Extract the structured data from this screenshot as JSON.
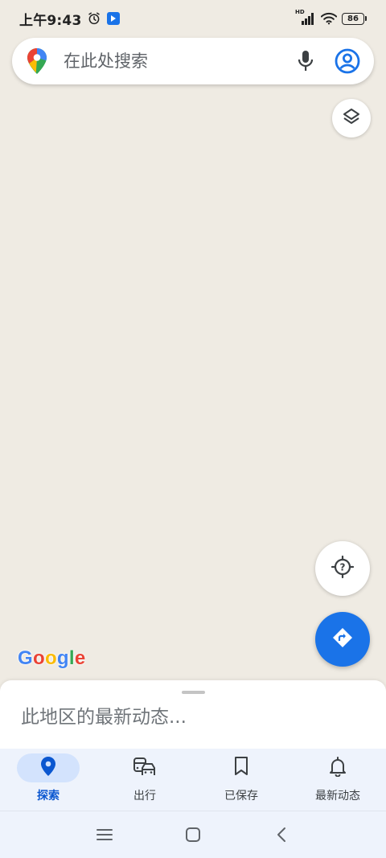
{
  "status_bar": {
    "time": "上午9:43",
    "network_label": "HD",
    "battery": "86"
  },
  "search": {
    "placeholder": "在此处搜索"
  },
  "map": {
    "background_color": "#efebe3",
    "logo_text": "Google"
  },
  "sheet": {
    "title": "此地区的最新动态..."
  },
  "bottom_nav": {
    "items": [
      {
        "label": "探索",
        "icon": "location-pin-icon",
        "active": true
      },
      {
        "label": "出行",
        "icon": "commute-icon",
        "active": false
      },
      {
        "label": "已保存",
        "icon": "bookmark-icon",
        "active": false
      },
      {
        "label": "最新动态",
        "icon": "bell-icon",
        "active": false
      }
    ]
  },
  "colors": {
    "accent": "#1a73e8",
    "active_nav": "#0b57d0",
    "active_pill": "#d3e3fd"
  }
}
